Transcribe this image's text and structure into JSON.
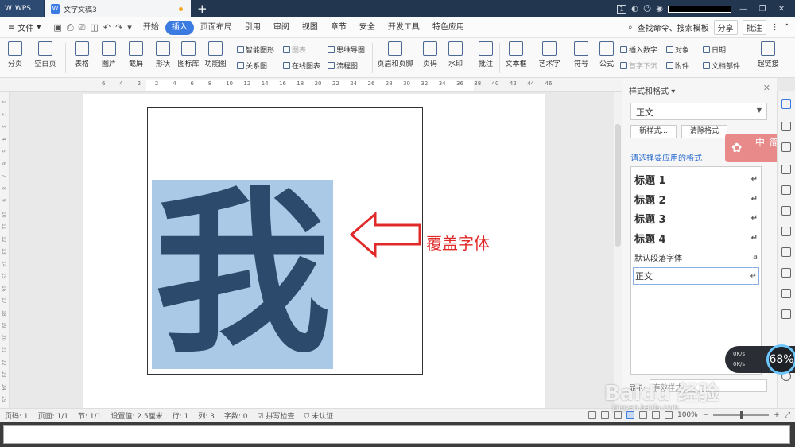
{
  "titlebar": {
    "app_name": "WPS",
    "doc_tab": "文字文稿3",
    "add_tab": "+",
    "badge": "1",
    "minimize": "—",
    "maximize": "❐",
    "close": "✕"
  },
  "menubar": {
    "file": "文件",
    "tabs": [
      "开始",
      "插入",
      "页面布局",
      "引用",
      "审阅",
      "视图",
      "章节",
      "安全",
      "开发工具",
      "特色应用"
    ],
    "active_tab": "插入",
    "search": "查找命令、搜索模板",
    "share": "分享",
    "comment": "批注"
  },
  "ribbon": {
    "page_break": "分页",
    "blank_page": "空白页",
    "table": "表格",
    "picture": "图片",
    "screenshot": "截屏",
    "shape": "形状",
    "icon_lib": "图标库",
    "func_chart": "功能图",
    "smart_shape": "智能图形",
    "chart": "图表",
    "mind_map": "思维导图",
    "relation": "关系图",
    "online_chart": "在线图表",
    "flowchart": "流程图",
    "header_footer": "页眉和页脚",
    "page_num": "页码",
    "watermark": "水印",
    "comment": "批注",
    "textbox": "文本框",
    "art_text": "艺术字",
    "symbol": "符号",
    "formula": "公式",
    "insert_number": "插入数字",
    "first_drop": "首字下沉",
    "object": "对象",
    "attachment": "附件",
    "date": "日期",
    "doc_part": "文档部件",
    "hyperlink": "超链接"
  },
  "ruler": {
    "labels": [
      "6",
      "4",
      "2",
      "2",
      "4",
      "6",
      "8",
      "10",
      "12",
      "14",
      "16",
      "18",
      "20",
      "22",
      "24",
      "26",
      "28",
      "30",
      "32",
      "34",
      "36",
      "38",
      "40",
      "42",
      "44",
      "46"
    ],
    "vlabels": [
      "1",
      "2",
      "3",
      "4",
      "5",
      "6",
      "7",
      "8",
      "9",
      "10",
      "11",
      "12",
      "13",
      "14",
      "15",
      "16",
      "17",
      "18",
      "19",
      "20",
      "21",
      "22",
      "23",
      "24",
      "25"
    ]
  },
  "document": {
    "big_char": "我",
    "annotation": "覆盖字体",
    "arrow_color": "#e02a2a",
    "char_bg": "#a9c9e7",
    "char_color": "#2c4a6b"
  },
  "panel": {
    "title": "样式和格式",
    "current_style": "正文",
    "new_style": "新样式...",
    "clear_format": "清除格式",
    "hint": "请选择要应用的格式",
    "styles": [
      {
        "name": "标题 1",
        "mark": "↵"
      },
      {
        "name": "标题 2",
        "mark": "↵"
      },
      {
        "name": "标题 3",
        "mark": "↵"
      },
      {
        "name": "标题 4",
        "mark": "↵"
      },
      {
        "name": "默认段落字体",
        "mark": "a"
      },
      {
        "name": "正文",
        "mark": "↵"
      }
    ],
    "show_label": "显示:",
    "show_value": "有效样式"
  },
  "ime": {
    "mode1": "中",
    "mode2": "简"
  },
  "speed": {
    "up": "0K/s",
    "down": "0K/s",
    "percent": "68%"
  },
  "status": {
    "page_no": "页码: 1",
    "pages": "页面: 1/1",
    "section": "节: 1/1",
    "setting": "设置值: 2.5厘米",
    "row": "行: 1",
    "col": "列: 3",
    "words": "字数: 0",
    "spell": "拼写检查",
    "auth": "未认证",
    "zoom": "100%"
  },
  "watermark": {
    "brand": "Baidu 经验",
    "url": "jingyan.baidu.com"
  }
}
